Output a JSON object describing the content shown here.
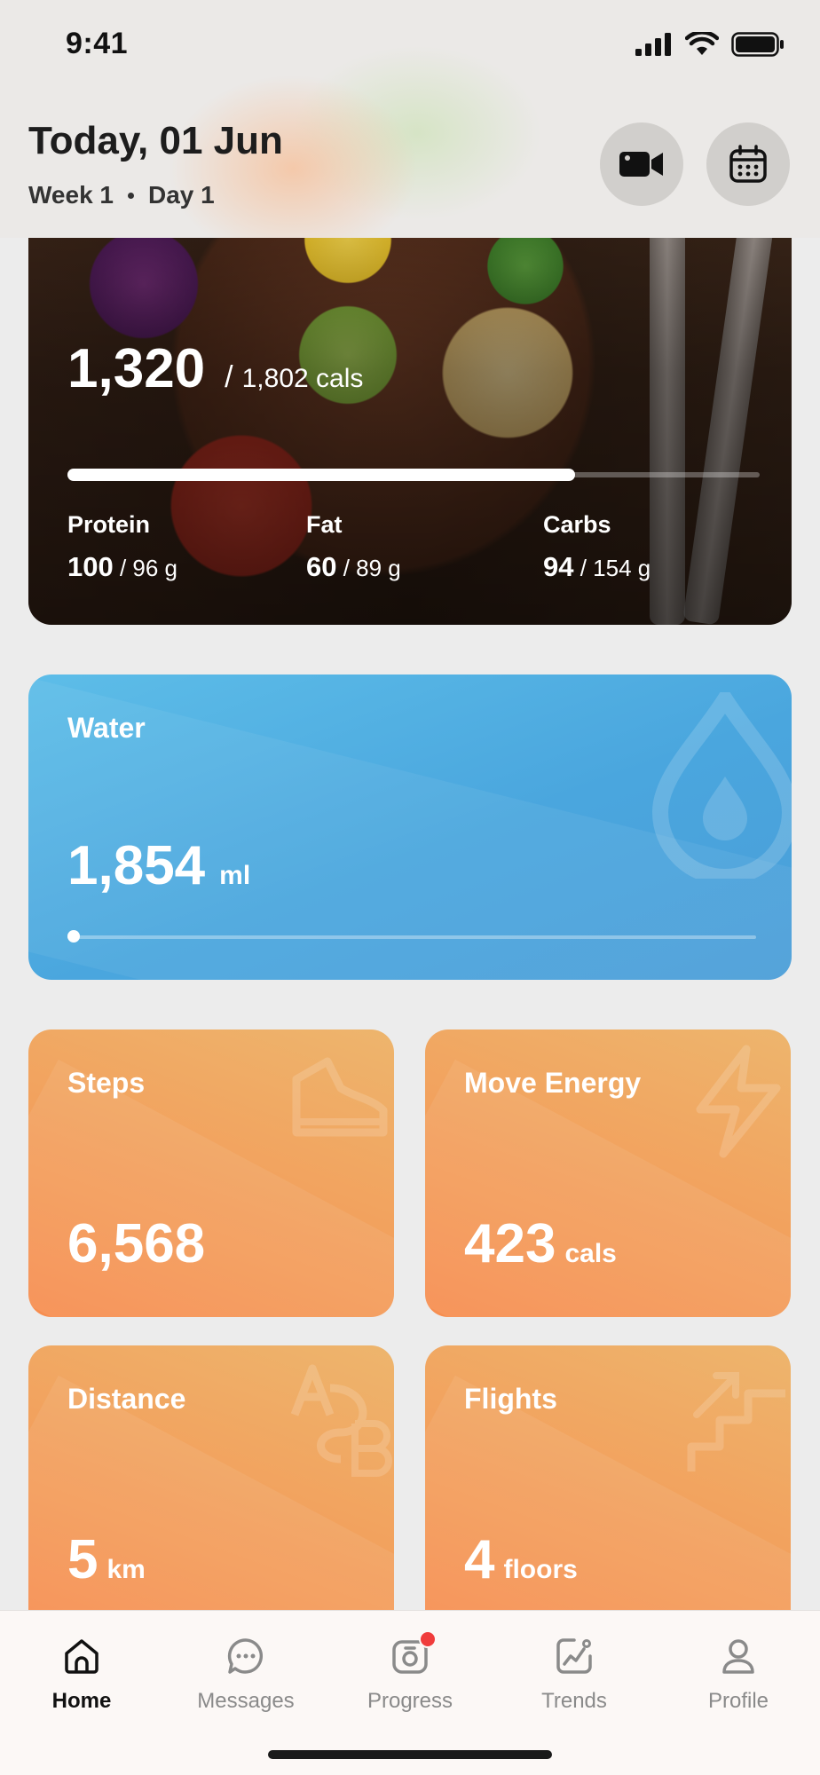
{
  "status_bar": {
    "time": "9:41"
  },
  "header": {
    "title": "Today, 01 Jun",
    "week": "Week 1",
    "day": "Day 1"
  },
  "calories": {
    "consumed": "1,320",
    "slash": "/",
    "goal": "1,802 cals",
    "progress": 0.733,
    "macros": [
      {
        "label": "Protein",
        "value": "100",
        "goal": "/ 96 g"
      },
      {
        "label": "Fat",
        "value": "60",
        "goal": "/ 89 g"
      },
      {
        "label": "Carbs",
        "value": "94",
        "goal": "/ 154 g"
      }
    ]
  },
  "water": {
    "label": "Water",
    "value": "1,854",
    "unit": "ml",
    "progress": 0.0
  },
  "steps": {
    "label": "Steps",
    "value": "6,568",
    "unit": ""
  },
  "move_energy": {
    "label": "Move Energy",
    "value": "423",
    "unit": "cals"
  },
  "distance": {
    "label": "Distance",
    "value": "5",
    "unit": "km"
  },
  "flights": {
    "label": "Flights",
    "value": "4",
    "unit": "floors"
  },
  "tabs": [
    {
      "label": "Home",
      "icon": "home-icon",
      "active": true
    },
    {
      "label": "Messages",
      "icon": "messages-icon",
      "active": false
    },
    {
      "label": "Progress",
      "icon": "progress-icon",
      "active": false,
      "badge": true
    },
    {
      "label": "Trends",
      "icon": "trends-icon",
      "active": false
    },
    {
      "label": "Profile",
      "icon": "profile-icon",
      "active": false
    }
  ],
  "colors": {
    "water_card": "#4aa6de",
    "activity_card": "#f2a35f",
    "badge": "#f03c3c"
  }
}
